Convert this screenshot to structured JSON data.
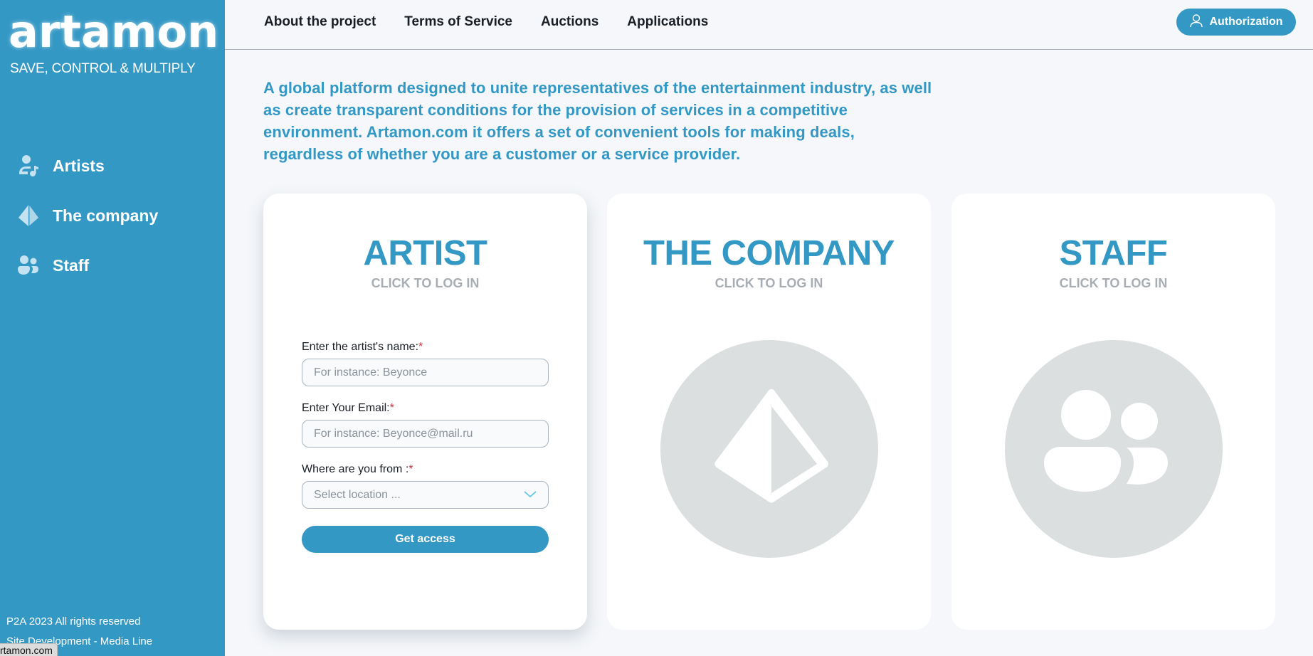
{
  "sidebar": {
    "logo": "artamon",
    "tagline": "SAVE, CONTROL & MULTIPLY",
    "items": [
      {
        "label": "Artists",
        "icon": "artist-music-icon"
      },
      {
        "label": "The company",
        "icon": "pyramid-icon"
      },
      {
        "label": "Staff",
        "icon": "people-icon"
      }
    ],
    "copyright": "P2A 2023 All rights reserved",
    "developer": "Site Development - Media Line"
  },
  "status_bar": {
    "url": "rtamon.com"
  },
  "header": {
    "nav": [
      "About the project",
      "Terms of Service",
      "Auctions",
      "Applications"
    ],
    "auth_button": "Authorization"
  },
  "intro": "A global platform designed to unite representatives of the entertainment industry, as well as create transparent conditions for the provision of services in a competitive environment. Artamon.com it offers a set of convenient tools for making deals, regardless of whether you are a customer or a service provider.",
  "cards": [
    {
      "title": "ARTIST",
      "subtitle": "CLICK TO LOG IN",
      "form": {
        "name_label": "Enter the artist's name:",
        "name_placeholder": "For instance: Beyonce",
        "email_label": "Enter Your Email:",
        "email_placeholder": "For instance: Beyonce@mail.ru",
        "location_label": "Where are you from :",
        "location_placeholder": "Select location ...",
        "required_mark": "*",
        "submit": "Get access"
      }
    },
    {
      "title": "THE COMPANY",
      "subtitle": "CLICK TO LOG IN"
    },
    {
      "title": "STAFF",
      "subtitle": "CLICK TO LOG IN"
    }
  ],
  "colors": {
    "brand": "#3498c5",
    "placeholder_circle": "#dcdfe0",
    "required": "#d0303c"
  }
}
